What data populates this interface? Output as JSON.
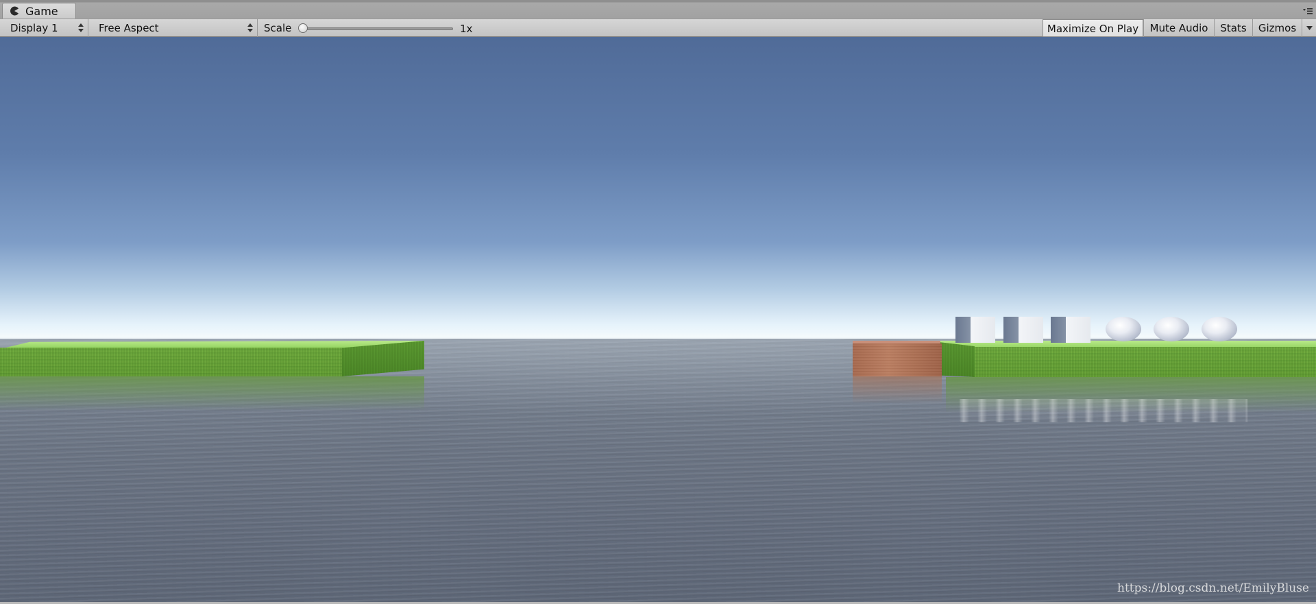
{
  "window": {
    "tab_title": "Game",
    "tab_icon": "pacman-icon",
    "menu_icon": "tab-menu-icon"
  },
  "toolbar": {
    "display": "Display 1",
    "aspect": "Free Aspect",
    "scale_label": "Scale",
    "scale_value": "1x",
    "scale_level": 0.0,
    "maximize_on_play": "Maximize On Play",
    "maximize_on_play_active": true,
    "mute_audio": "Mute Audio",
    "stats": "Stats",
    "gizmos": "Gizmos"
  },
  "viewport": {
    "watermark": "https://blog.csdn.net/EmilyBluse"
  },
  "colors": {
    "sky_top": "#506b98",
    "horizon": "#f3f9fc",
    "water": "#6e7888",
    "grass": "#6aa83e",
    "wood": "#b87a5c"
  }
}
